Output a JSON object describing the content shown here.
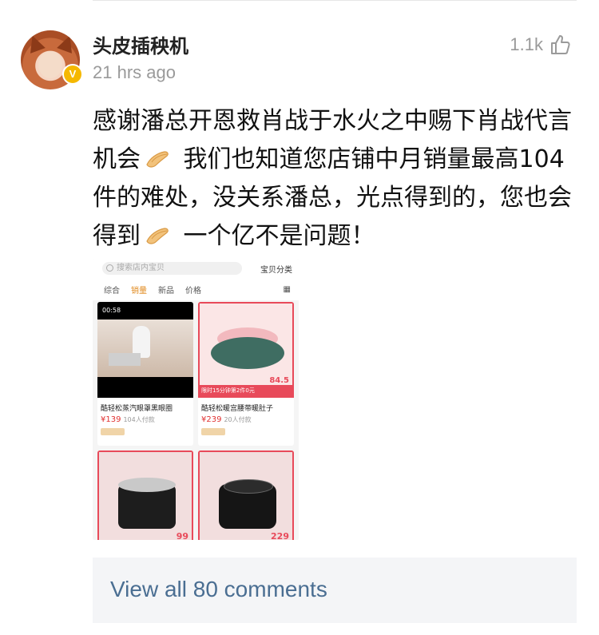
{
  "post": {
    "username": "头皮插秧机",
    "timestamp": "21 hrs ago",
    "likes": "1.1k",
    "text_parts": [
      "感谢潘总开恩救肖战于水火之中赐下肖战代言机会",
      " 我们也知道您店铺中月销量最高104件的难处，没关系潘总，光点得到的，您也会得到",
      " 一个亿不是问题！"
    ],
    "icons": [
      "verified-badge-icon",
      "thumbs-up-icon",
      "folded-hands-emoji"
    ]
  },
  "embedded_shop": {
    "search_placeholder": "搜索店内宝贝",
    "category_label": "宝贝分类",
    "tabs": [
      "综合",
      "销量",
      "新品",
      "价格"
    ],
    "active_tab": "销量",
    "products": [
      {
        "title": "酷轻松蒸汽眼罩黑眼圈",
        "price": "¥139",
        "paid": "104人付款",
        "video_time": "00:58"
      },
      {
        "title": "酷轻松暖宫腰带暖肚子",
        "price": "¥239",
        "paid": "20人付款",
        "promo": "限时15分钟第2件0元",
        "promo_price": "84.5"
      },
      {
        "price_partial": "99"
      },
      {
        "price_partial": "229"
      }
    ]
  },
  "comments": {
    "view_all_label": "View all 80 comments"
  },
  "colors": {
    "accent_link": "#4a6e92",
    "muted": "#9a9a9a",
    "badge": "#f5b800",
    "shop_red": "#e84a5a"
  }
}
